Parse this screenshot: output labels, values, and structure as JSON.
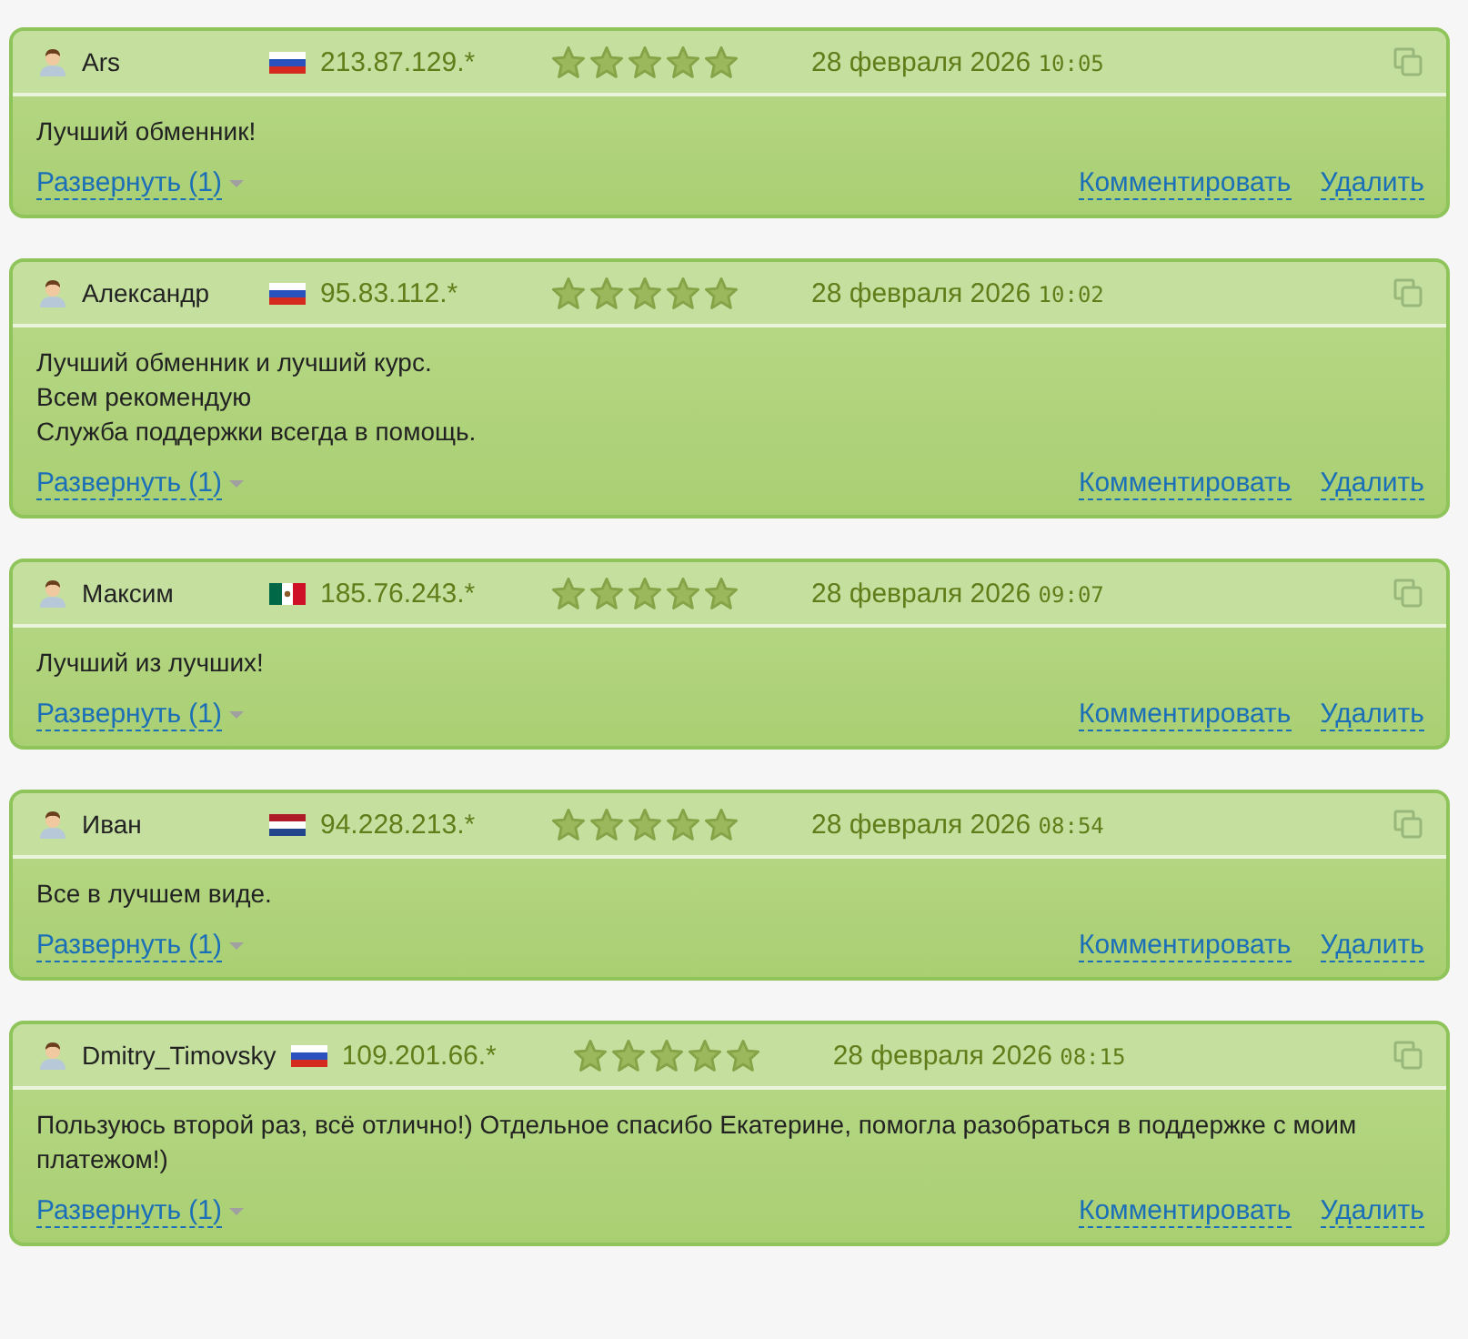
{
  "reviews": [
    {
      "author": "Ars",
      "kind": "ru",
      "ip": "213.87.129.*",
      "stars": 5,
      "date": "28 февраля 2026",
      "time": "10:05",
      "text": "Лучший обменник!",
      "expand": "Развернуть (1)",
      "comment": "Комментировать",
      "delete": "Удалить"
    },
    {
      "author": "Александр",
      "kind": "ru",
      "ip": "95.83.112.*",
      "stars": 5,
      "date": "28 февраля 2026",
      "time": "10:02",
      "text": "Лучший обменник и лучший курс.\nВсем рекомендую\nСлужба поддержки всегда в помощь.",
      "expand": "Развернуть (1)",
      "comment": "Комментировать",
      "delete": "Удалить"
    },
    {
      "author": "Максим",
      "kind": "mx",
      "ip": "185.76.243.*",
      "stars": 5,
      "date": "28 февраля 2026",
      "time": "09:07",
      "text": "Лучший из лучших!",
      "expand": "Развернуть (1)",
      "comment": "Комментировать",
      "delete": "Удалить"
    },
    {
      "author": "Иван",
      "kind": "nl",
      "ip": "94.228.213.*",
      "stars": 5,
      "date": "28 февраля 2026",
      "time": "08:54",
      "text": "Все в лучшем виде.",
      "expand": "Развернуть (1)",
      "comment": "Комментировать",
      "delete": "Удалить"
    },
    {
      "author": "Dmitry_Timovsky",
      "kind": "ru",
      "ip": "109.201.66.*",
      "stars": 5,
      "date": "28 февраля 2026",
      "time": "08:15",
      "text": "Пользуюсь второй раз, всё отлично!) Отдельное спасибо Екатерине, помогла разобраться в поддержке с моим платежом!)",
      "expand": "Развернуть (1)",
      "comment": "Комментировать",
      "delete": "Удалить"
    }
  ]
}
